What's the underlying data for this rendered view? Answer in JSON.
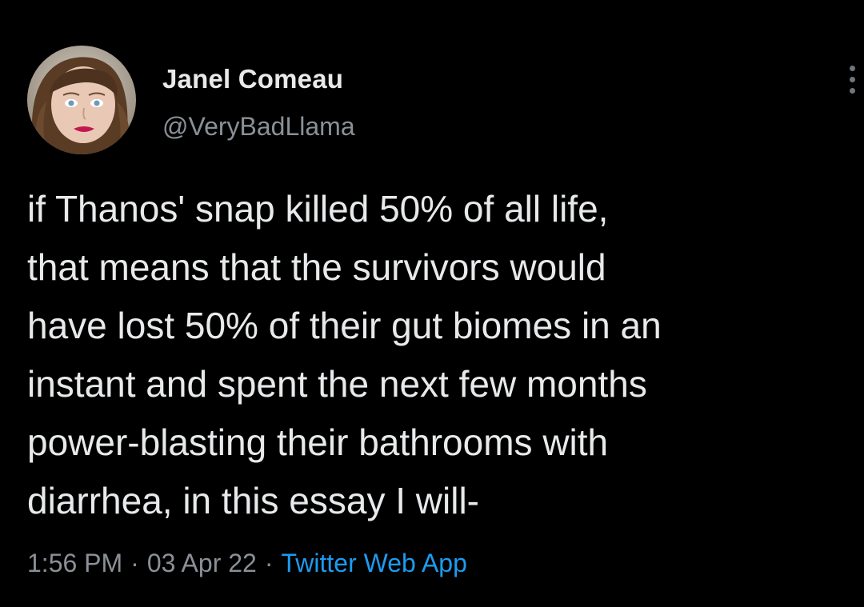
{
  "author": {
    "display_name": "Janel Comeau",
    "handle": "@VeryBadLlama"
  },
  "tweet": {
    "lines": [
      "if Thanos' snap killed 50% of all life,",
      "that means that the survivors would",
      "have lost 50% of their gut biomes in an",
      "instant and spent the next few months",
      "power-blasting their bathrooms with",
      "diarrhea, in this essay I will-"
    ]
  },
  "meta": {
    "time": "1:56 PM",
    "date": "03 Apr 22",
    "separator": "·",
    "source": "Twitter Web App"
  },
  "icons": {
    "more": "more-options-icon",
    "avatar": "avatar"
  },
  "colors": {
    "background": "#000000",
    "text": "#e7e9ea",
    "secondary": "#8b9096",
    "link": "#1d9bf0"
  }
}
